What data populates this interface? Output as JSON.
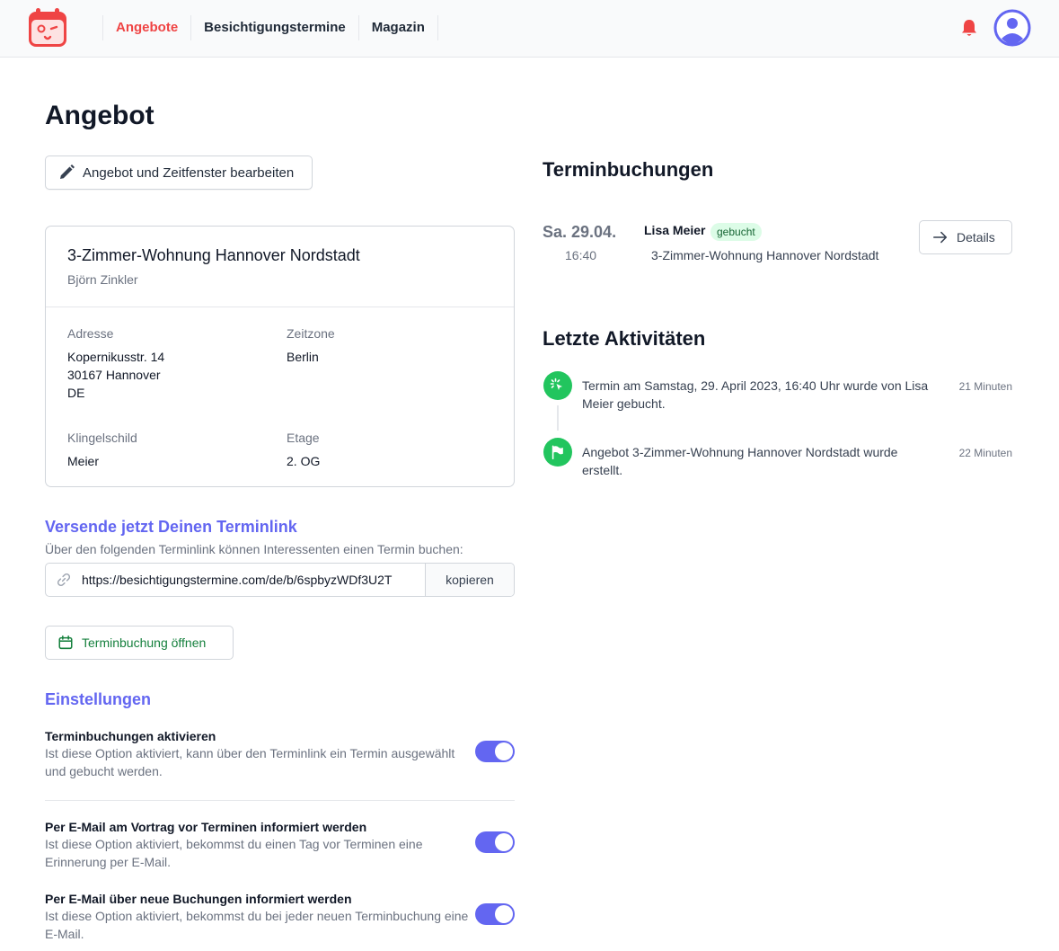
{
  "nav": {
    "items": [
      "Angebote",
      "Besichtigungstermine",
      "Magazin"
    ]
  },
  "page": {
    "title": "Angebot",
    "edit_label": "Angebot und Zeitfenster bearbeiten"
  },
  "offer": {
    "title": "3-Zimmer-Wohnung Hannover Nordstadt",
    "owner": "Björn Zinkler",
    "address_label": "Adresse",
    "address_line1": "Kopernikusstr. 14",
    "address_line2": "30167 Hannover",
    "address_line3": "DE",
    "timezone_label": "Zeitzone",
    "timezone": "Berlin",
    "bell_label": "Klingelschild",
    "bell_value": "Meier",
    "floor_label": "Etage",
    "floor_value": "2. OG"
  },
  "link": {
    "heading": "Versende jetzt Deinen Terminlink",
    "hint": "Über den folgenden Terminlink können Interessenten einen Termin buchen:",
    "url": "https://besichtigungstermine.com/de/b/6spbyzWDf3U2T",
    "copy_label": "kopieren",
    "open_label": "Terminbuchung öffnen"
  },
  "settings": {
    "heading": "Einstellungen",
    "items": [
      {
        "title": "Terminbuchungen aktivieren",
        "desc": "Ist diese Option aktiviert, kann über den Terminlink ein Termin ausgewählt und gebucht werden.",
        "enabled": true
      },
      {
        "title": "Per E-Mail am Vortrag vor Terminen informiert werden",
        "desc": "Ist diese Option aktiviert, bekommst du einen Tag vor Terminen eine Erinnerung per E-Mail.",
        "enabled": true
      },
      {
        "title": "Per E-Mail über neue Buchungen informiert werden",
        "desc": "Ist diese Option aktiviert, bekommst du bei jeder neuen Terminbuchung eine E-Mail.",
        "enabled": true
      }
    ]
  },
  "bookings": {
    "heading": "Terminbuchungen",
    "items": [
      {
        "date": "Sa. 29.04.",
        "time": "16:40",
        "name": "Lisa Meier",
        "status": "gebucht",
        "offer": "3-Zimmer-Wohnung Hannover Nordstadt",
        "details_label": "Details"
      }
    ]
  },
  "activities": {
    "heading": "Letzte Aktivitäten",
    "items": [
      {
        "icon": "cursor-click-icon",
        "text": "Termin am Samstag, 29. April 2023, 16:40 Uhr wurde von Lisa Meier gebucht.",
        "time": "21 Minuten"
      },
      {
        "icon": "flag-icon",
        "text": "Angebot 3-Zimmer-Wohnung Hannover Nordstadt wurde erstellt.",
        "time": "22 Minuten"
      }
    ]
  },
  "colors": {
    "accent": "#6366f1",
    "brand": "#ef4444",
    "success": "#22c55e"
  }
}
